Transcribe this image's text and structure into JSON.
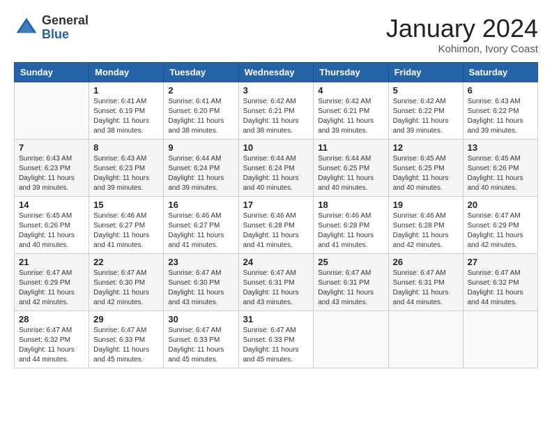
{
  "header": {
    "logo_general": "General",
    "logo_blue": "Blue",
    "month_title": "January 2024",
    "location": "Kohimon, Ivory Coast"
  },
  "days_of_week": [
    "Sunday",
    "Monday",
    "Tuesday",
    "Wednesday",
    "Thursday",
    "Friday",
    "Saturday"
  ],
  "weeks": [
    [
      {
        "day": "",
        "info": ""
      },
      {
        "day": "1",
        "info": "Sunrise: 6:41 AM\nSunset: 6:19 PM\nDaylight: 11 hours and 38 minutes."
      },
      {
        "day": "2",
        "info": "Sunrise: 6:41 AM\nSunset: 6:20 PM\nDaylight: 11 hours and 38 minutes."
      },
      {
        "day": "3",
        "info": "Sunrise: 6:42 AM\nSunset: 6:21 PM\nDaylight: 11 hours and 38 minutes."
      },
      {
        "day": "4",
        "info": "Sunrise: 6:42 AM\nSunset: 6:21 PM\nDaylight: 11 hours and 39 minutes."
      },
      {
        "day": "5",
        "info": "Sunrise: 6:42 AM\nSunset: 6:22 PM\nDaylight: 11 hours and 39 minutes."
      },
      {
        "day": "6",
        "info": "Sunrise: 6:43 AM\nSunset: 6:22 PM\nDaylight: 11 hours and 39 minutes."
      }
    ],
    [
      {
        "day": "7",
        "info": "Sunrise: 6:43 AM\nSunset: 6:23 PM\nDaylight: 11 hours and 39 minutes."
      },
      {
        "day": "8",
        "info": "Sunrise: 6:43 AM\nSunset: 6:23 PM\nDaylight: 11 hours and 39 minutes."
      },
      {
        "day": "9",
        "info": "Sunrise: 6:44 AM\nSunset: 6:24 PM\nDaylight: 11 hours and 39 minutes."
      },
      {
        "day": "10",
        "info": "Sunrise: 6:44 AM\nSunset: 6:24 PM\nDaylight: 11 hours and 40 minutes."
      },
      {
        "day": "11",
        "info": "Sunrise: 6:44 AM\nSunset: 6:25 PM\nDaylight: 11 hours and 40 minutes."
      },
      {
        "day": "12",
        "info": "Sunrise: 6:45 AM\nSunset: 6:25 PM\nDaylight: 11 hours and 40 minutes."
      },
      {
        "day": "13",
        "info": "Sunrise: 6:45 AM\nSunset: 6:26 PM\nDaylight: 11 hours and 40 minutes."
      }
    ],
    [
      {
        "day": "14",
        "info": "Sunrise: 6:45 AM\nSunset: 6:26 PM\nDaylight: 11 hours and 40 minutes."
      },
      {
        "day": "15",
        "info": "Sunrise: 6:46 AM\nSunset: 6:27 PM\nDaylight: 11 hours and 41 minutes."
      },
      {
        "day": "16",
        "info": "Sunrise: 6:46 AM\nSunset: 6:27 PM\nDaylight: 11 hours and 41 minutes."
      },
      {
        "day": "17",
        "info": "Sunrise: 6:46 AM\nSunset: 6:28 PM\nDaylight: 11 hours and 41 minutes."
      },
      {
        "day": "18",
        "info": "Sunrise: 6:46 AM\nSunset: 6:28 PM\nDaylight: 11 hours and 41 minutes."
      },
      {
        "day": "19",
        "info": "Sunrise: 6:46 AM\nSunset: 6:28 PM\nDaylight: 11 hours and 42 minutes."
      },
      {
        "day": "20",
        "info": "Sunrise: 6:47 AM\nSunset: 6:29 PM\nDaylight: 11 hours and 42 minutes."
      }
    ],
    [
      {
        "day": "21",
        "info": "Sunrise: 6:47 AM\nSunset: 6:29 PM\nDaylight: 11 hours and 42 minutes."
      },
      {
        "day": "22",
        "info": "Sunrise: 6:47 AM\nSunset: 6:30 PM\nDaylight: 11 hours and 42 minutes."
      },
      {
        "day": "23",
        "info": "Sunrise: 6:47 AM\nSunset: 6:30 PM\nDaylight: 11 hours and 43 minutes."
      },
      {
        "day": "24",
        "info": "Sunrise: 6:47 AM\nSunset: 6:31 PM\nDaylight: 11 hours and 43 minutes."
      },
      {
        "day": "25",
        "info": "Sunrise: 6:47 AM\nSunset: 6:31 PM\nDaylight: 11 hours and 43 minutes."
      },
      {
        "day": "26",
        "info": "Sunrise: 6:47 AM\nSunset: 6:31 PM\nDaylight: 11 hours and 44 minutes."
      },
      {
        "day": "27",
        "info": "Sunrise: 6:47 AM\nSunset: 6:32 PM\nDaylight: 11 hours and 44 minutes."
      }
    ],
    [
      {
        "day": "28",
        "info": "Sunrise: 6:47 AM\nSunset: 6:32 PM\nDaylight: 11 hours and 44 minutes."
      },
      {
        "day": "29",
        "info": "Sunrise: 6:47 AM\nSunset: 6:33 PM\nDaylight: 11 hours and 45 minutes."
      },
      {
        "day": "30",
        "info": "Sunrise: 6:47 AM\nSunset: 6:33 PM\nDaylight: 11 hours and 45 minutes."
      },
      {
        "day": "31",
        "info": "Sunrise: 6:47 AM\nSunset: 6:33 PM\nDaylight: 11 hours and 45 minutes."
      },
      {
        "day": "",
        "info": ""
      },
      {
        "day": "",
        "info": ""
      },
      {
        "day": "",
        "info": ""
      }
    ]
  ]
}
